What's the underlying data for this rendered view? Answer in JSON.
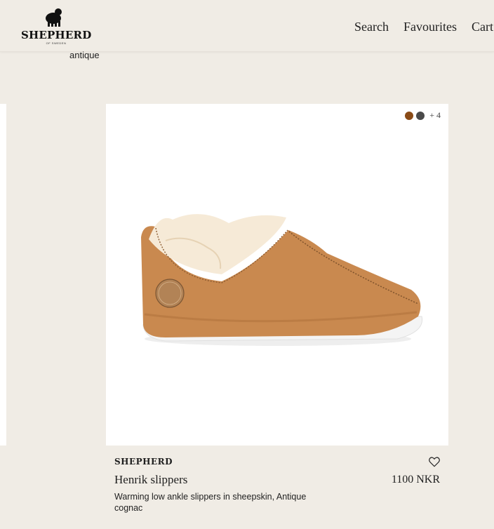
{
  "header": {
    "logo": {
      "name": "SHEPHERD",
      "subtitle": "OF SWEDEN"
    },
    "nav": [
      {
        "label": "Search"
      },
      {
        "label": "Favourites"
      },
      {
        "label": "Cart"
      }
    ]
  },
  "filter": {
    "label": "antique"
  },
  "product": {
    "brand": "SHEPHERD",
    "name": "Henrik slippers",
    "price": "1100 NKR",
    "description": "Warming low ankle slippers in sheepskin, Antique cognac",
    "swatches": [
      {
        "color": "#8a4b16"
      },
      {
        "color": "#4a4a4a"
      }
    ],
    "more_colors": "+ 4",
    "image_alt": "slipper-image"
  },
  "colors": {
    "background": "#f0ece5",
    "card": "#ffffff",
    "suede": "#c9894f"
  }
}
